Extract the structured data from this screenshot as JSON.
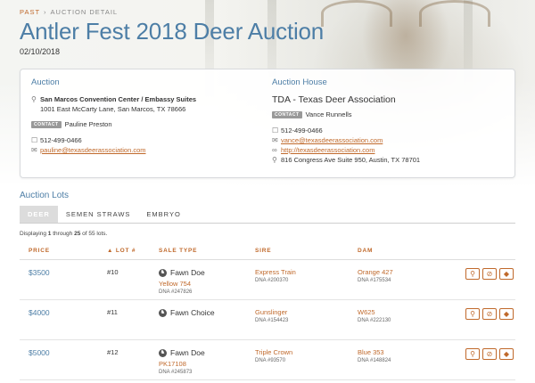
{
  "breadcrumb": {
    "past": "PAST",
    "separator": "›",
    "current": "AUCTION DETAIL"
  },
  "page": {
    "title": "Antler Fest 2018 Deer Auction",
    "date": "02/10/2018"
  },
  "auction": {
    "heading": "Auction",
    "venue": "San Marcos Convention Center / Embassy Suites",
    "address": "1001 East McCarty Lane, San Marcos, TX 78666",
    "contact_badge": "CONTACT",
    "contact_name": "Pauline Preston",
    "phone": "512-499-0466",
    "email": "pauline@texasdeerassociation.com"
  },
  "house": {
    "heading": "Auction House",
    "name": "TDA - Texas Deer Association",
    "contact_badge": "CONTACT",
    "contact_name": "Vance Runnells",
    "phone": "512-499-0466",
    "email": "vance@texasdeerassociation.com",
    "website": "http://texasdeerassociation.com",
    "address": "816 Congress Ave Suite 950, Austin, TX 78701"
  },
  "lots": {
    "heading": "Auction Lots",
    "tabs": [
      "DEER",
      "SEMEN STRAWS",
      "EMBRYO"
    ],
    "display_prefix": "Displaying ",
    "display_from": "1",
    "display_mid": " through ",
    "display_to": "25",
    "display_of": " of 55 lots.",
    "columns": {
      "price": "PRICE",
      "lot": "▲ LOT #",
      "sale_type": "SALE TYPE",
      "sire": "SIRE",
      "dam": "DAM"
    },
    "rows": [
      {
        "price": "$3500",
        "lot": "#10",
        "sale_type": "Fawn Doe",
        "sale_name": "Yellow 754",
        "sale_dna": "DNA #247826",
        "sire": "Express Train",
        "sire_dna": "DNA #200370",
        "dam": "Orange 427",
        "dam_dna": "DNA #175534"
      },
      {
        "price": "$4000",
        "lot": "#11",
        "sale_type": "Fawn Choice",
        "sale_name": "",
        "sale_dna": "",
        "sire": "Gunslinger",
        "sire_dna": "DNA #154423",
        "dam": "W625",
        "dam_dna": "DNA #222130"
      },
      {
        "price": "$5000",
        "lot": "#12",
        "sale_type": "Fawn Doe",
        "sale_name": "PK17108",
        "sale_dna": "DNA #245873",
        "sire": "Triple Crown",
        "sire_dna": "DNA #93570",
        "dam": "Blue 353",
        "dam_dna": "DNA #148824"
      }
    ]
  },
  "icons": {
    "row_actions": [
      "search-icon",
      "ban-icon",
      "tag-icon"
    ],
    "map_pin": "map-pin-icon",
    "phone": "phone-icon",
    "mail": "mail-icon",
    "link": "link-icon"
  },
  "colors": {
    "accent_blue": "#4d7ea6",
    "accent_orange": "#c0692b"
  }
}
